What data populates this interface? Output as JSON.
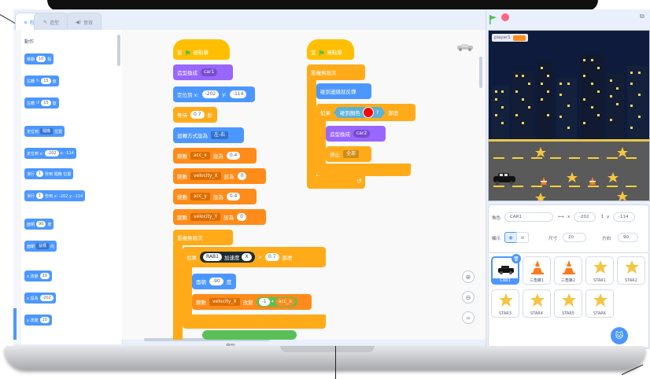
{
  "tabs": [
    {
      "label": "程式",
      "icon": "code-icon"
    },
    {
      "label": "造型",
      "icon": "brush-icon"
    },
    {
      "label": "音效",
      "icon": "speaker-icon"
    }
  ],
  "palette": {
    "category_title": "動作",
    "blocks": [
      {
        "text": "移動",
        "value": "10",
        "suffix": "點"
      },
      {
        "text": "右轉",
        "value": "15",
        "suffix": "度"
      },
      {
        "text": "左轉",
        "value": "15",
        "suffix": "度"
      },
      {
        "text": "定位到",
        "value": "隨機",
        "suffix": "位置"
      },
      {
        "text": "定位到 x:",
        "value": "-202",
        "suffix": "y: -114"
      },
      {
        "text": "滑行",
        "value": "1",
        "suffix": "秒到 隨機 位置"
      },
      {
        "text": "滑行",
        "value": "1",
        "suffix": "秒到 x: -202 y: -114"
      },
      {
        "text": "面朝",
        "value": "90",
        "suffix": "度"
      },
      {
        "text": "面朝",
        "value": "鼠標",
        "suffix": "向"
      },
      {
        "text": "x 改變",
        "value": "10",
        "suffix": ""
      },
      {
        "text": "x 設為",
        "value": "-202",
        "suffix": ""
      },
      {
        "text": "y 改變",
        "value": "10",
        "suffix": ""
      }
    ]
  },
  "script1": {
    "hat": "當",
    "hat2": "被點擊",
    "switch_costume": "造型換成",
    "costume": "car1",
    "goto_xy": "定位到 x:",
    "x": "-202",
    "y_lbl": "y:",
    "y": "-114",
    "wait": "等待",
    "wait_val": "0.7",
    "wait_unit": "秒",
    "rotation": "迴轉方式設為",
    "rotation_val": "左-右",
    "var_set": "變數",
    "set_to": "設為",
    "vars": [
      {
        "name": "acc_x",
        "value": "0.4"
      },
      {
        "name": "velocity_X",
        "value": "0"
      },
      {
        "name": "acc_y",
        "value": "0.4"
      },
      {
        "name": "velocity_Y",
        "value": "0"
      }
    ],
    "forever": "重複無限次",
    "if": "如果",
    "then": "那麼",
    "sensor": "RAB1",
    "sensor_prop": "加速度",
    "axis": "X",
    "compare_val": "0.7",
    "face": "面朝",
    "face_val": "-90",
    "face_unit": "度",
    "change_var": "velocity_X",
    "change_by": "改變",
    "mult_a": "-1",
    "mult_op": "*",
    "mult_b": "acc_x"
  },
  "script2": {
    "hat": "當",
    "hat2": "被點擊",
    "forever": "重複無限次",
    "bounce": "碰到邊緣就反彈",
    "if": "如果",
    "touching_color": "碰到顏色",
    "question": "?",
    "then": "那麼",
    "switch_costume": "造型換成",
    "costume": "car2",
    "stop": "停止",
    "stop_val": "全部"
  },
  "caption": "背包",
  "stage": {
    "player_label": "player1",
    "player_value": ""
  },
  "sprite_info": {
    "sprite_lbl": "角色",
    "name": "CAR1",
    "x_lbl": "x",
    "x": "-202",
    "y_lbl": "y",
    "y": "-114",
    "show_lbl": "顯示",
    "size_lbl": "尺寸",
    "size": "20",
    "dir_lbl": "方向",
    "direction": "90"
  },
  "sprites": [
    {
      "name": "CAR1",
      "kind": "car"
    },
    {
      "name": "三角錐1",
      "kind": "cone"
    },
    {
      "name": "三角錐2",
      "kind": "cone"
    },
    {
      "name": "STAR1",
      "kind": "star"
    },
    {
      "name": "STAR2",
      "kind": "star"
    },
    {
      "name": "STAR3",
      "kind": "star"
    },
    {
      "name": "STAR4",
      "kind": "star"
    },
    {
      "name": "STAR5",
      "kind": "star"
    },
    {
      "name": "STAR6",
      "kind": "star"
    }
  ],
  "colors": {
    "motion": "#4c97ff",
    "looks": "#9966ff",
    "control": "#ffab19",
    "variables": "#ff8c1a",
    "events": "#ffbf00",
    "sensing": "#5cb1d6",
    "operators": "#59c059",
    "stage_sky": "#0e1b3c",
    "road": "#5a5a5a",
    "touch_color": "#ff0000"
  }
}
